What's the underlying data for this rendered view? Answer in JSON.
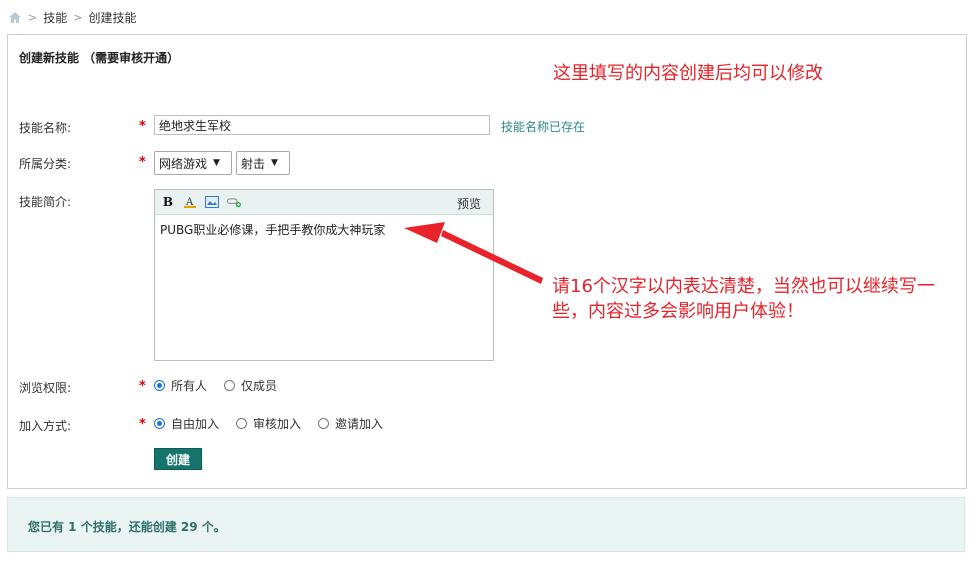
{
  "breadcrumb": {
    "items": [
      "技能",
      "创建技能"
    ]
  },
  "panel": {
    "title": "创建新技能 （需要审核开通）"
  },
  "annotations": {
    "top_note": "这里填写的内容创建后均可以修改",
    "mid_note": "请16个汉字以内表达清楚，当然也可以继续写一些，内容过多会影响用户体验！"
  },
  "form": {
    "required_mark": "*",
    "name": {
      "label": "技能名称:",
      "value": "绝地求生军校",
      "hint": "技能名称已存在"
    },
    "category": {
      "label": "所属分类:",
      "primary": "网络游戏",
      "secondary": "射击"
    },
    "intro": {
      "label": "技能简介:",
      "preview_label": "预览",
      "text": "PUBG职业必修课，手把手教你成大神玩家"
    },
    "visibility": {
      "label": "浏览权限:",
      "options": [
        "所有人",
        "仅成员"
      ],
      "selected": "所有人"
    },
    "join": {
      "label": "加入方式:",
      "options": [
        "自由加入",
        "审核加入",
        "邀请加入"
      ],
      "selected": "自由加入"
    },
    "submit_label": "创建"
  },
  "footer": {
    "text": "您已有 1 个技能，还能创建 29 个。"
  },
  "colors": {
    "accent": "#15756c",
    "annotation": "#e8232a",
    "hint": "#2f8a86",
    "footer_bg": "#eaf4f3"
  }
}
